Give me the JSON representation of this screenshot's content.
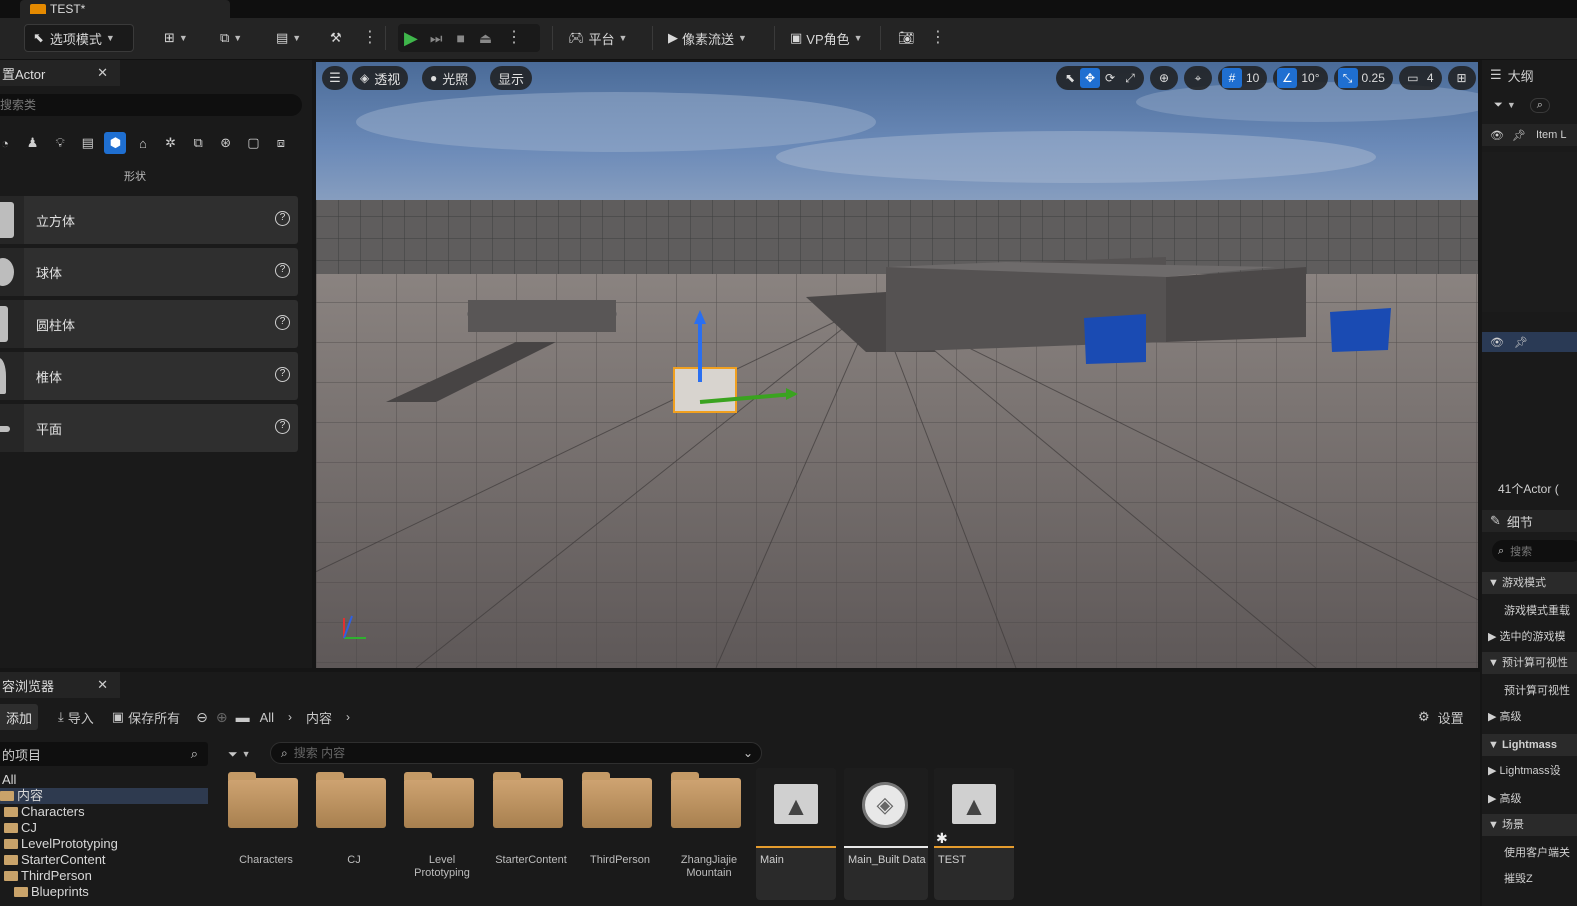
{
  "tabs": {
    "document": "TEST*"
  },
  "toolbar": {
    "mode": "选项模式",
    "platform": "平台",
    "pixel_streaming": "像素流送",
    "vp_role": "VP角色"
  },
  "place_actors": {
    "title": "置Actor",
    "search_placeholder": "搜索类",
    "category_label": "形状",
    "items": [
      {
        "label": "立方体"
      },
      {
        "label": "球体"
      },
      {
        "label": "圆柱体"
      },
      {
        "label": "椎体"
      },
      {
        "label": "平面"
      }
    ]
  },
  "viewport": {
    "perspective": "透视",
    "lighting": "光照",
    "show": "显示",
    "grid_snap": "10",
    "angle_snap": "10°",
    "scale_snap": "0.25",
    "camera_speed": "4"
  },
  "outliner": {
    "title": "大纲",
    "column_item": "Item L",
    "actor_count": "41个Actor ("
  },
  "details": {
    "title": "细节",
    "search_placeholder": "搜索",
    "rows": [
      "游戏模式",
      "游戏模式重载",
      "选中的游戏模",
      "预计算可视性",
      "预计算可视性",
      "高级",
      "Lightmass",
      "Lightmass设",
      "高级",
      "场景",
      "使用客户端关",
      "摧毁Z"
    ]
  },
  "content_browser": {
    "title": "容浏览器",
    "add": "添加",
    "import": "导入",
    "save_all": "保存所有",
    "path_all": "All",
    "path_content": "内容",
    "settings": "设置",
    "tree_header": "的项目",
    "filter_placeholder": "搜索 内容",
    "tree": [
      "All",
      "内容",
      "Characters",
      "CJ",
      "LevelPrototyping",
      "StarterContent",
      "ThirdPerson",
      "Blueprints"
    ],
    "assets": [
      {
        "name": "Characters"
      },
      {
        "name": "CJ"
      },
      {
        "name": "Level Prototyping"
      },
      {
        "name": "StarterContent"
      },
      {
        "name": "ThirdPerson"
      },
      {
        "name": "ZhangJiajie Mountain"
      },
      {
        "name": "Main"
      },
      {
        "name": "Main_Built Data"
      },
      {
        "name": "TEST"
      }
    ]
  },
  "colors": {
    "accent": "#1f6fd1",
    "play": "#3fb64b",
    "orange": "#e59c2e"
  }
}
